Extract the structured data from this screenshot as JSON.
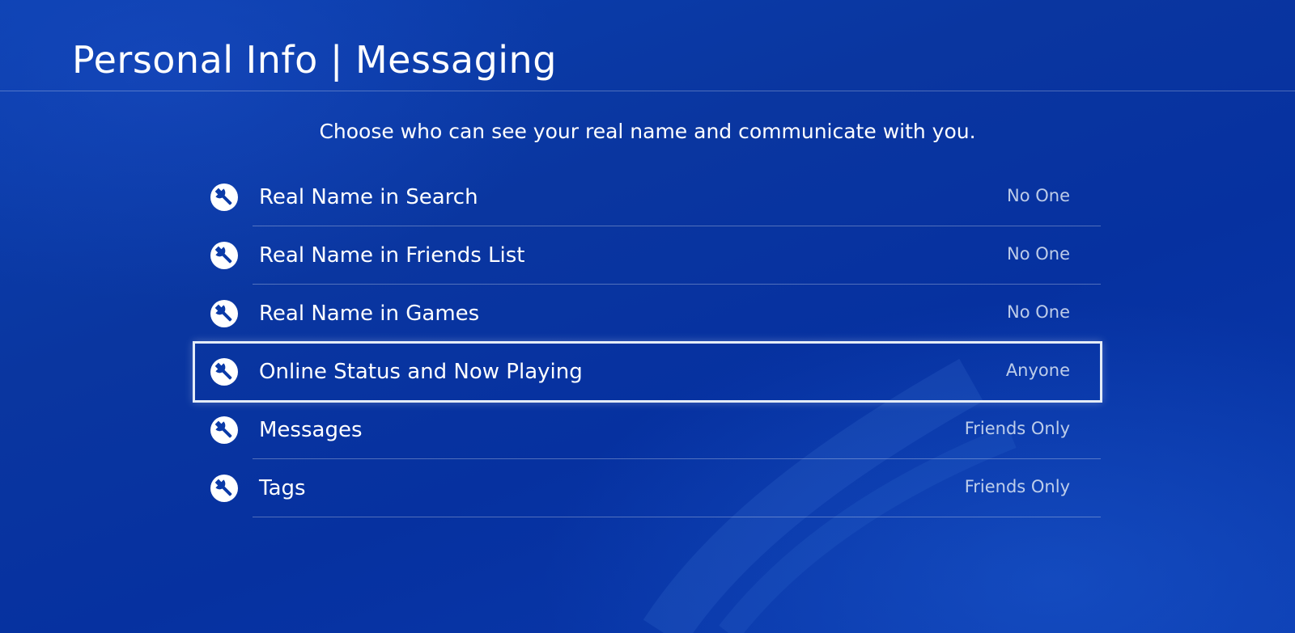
{
  "header": {
    "title": "Personal Info | Messaging"
  },
  "subtitle": "Choose who can see your real name and communicate with you.",
  "theme": {
    "background": "#0a3aa8",
    "selection_border": "#e4ecf7"
  },
  "settings": [
    {
      "label": "Real Name in Search",
      "value": "No One",
      "icon": "wrench-icon",
      "selected": false
    },
    {
      "label": "Real Name in Friends List",
      "value": "No One",
      "icon": "wrench-icon",
      "selected": false
    },
    {
      "label": "Real Name in Games",
      "value": "No One",
      "icon": "wrench-icon",
      "selected": false
    },
    {
      "label": "Online Status and Now Playing",
      "value": "Anyone",
      "icon": "wrench-icon",
      "selected": true
    },
    {
      "label": "Messages",
      "value": "Friends Only",
      "icon": "wrench-icon",
      "selected": false
    },
    {
      "label": "Tags",
      "value": "Friends Only",
      "icon": "wrench-icon",
      "selected": false
    }
  ]
}
